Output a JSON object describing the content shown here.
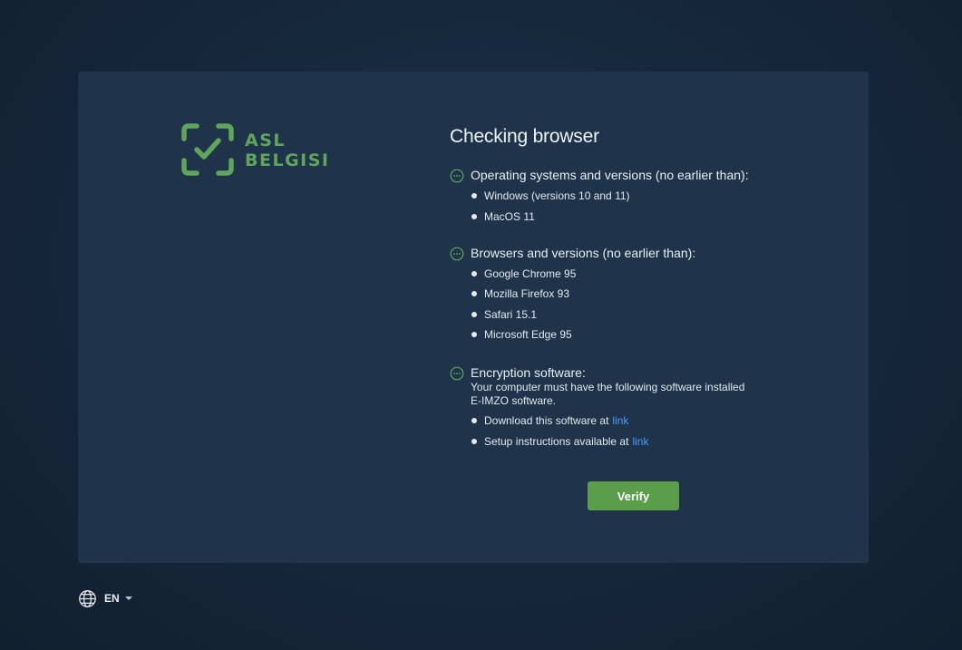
{
  "logo": {
    "line1": "ASL",
    "line2": "BELGISI",
    "color": "#5fa55a"
  },
  "title": "Checking browser",
  "sections": [
    {
      "title": "Operating systems and versions (no earlier than):",
      "items": [
        "Windows (versions 10 and 11)",
        "MacOS 11"
      ]
    },
    {
      "title": "Browsers and versions (no earlier than):",
      "items": [
        "Google Chrome 95",
        "Mozilla Firefox 93",
        "Safari 15.1",
        "Microsoft Edge 95"
      ]
    },
    {
      "title": "Encryption software:",
      "desc1": "Your computer must have the following software installed",
      "desc2": "E-IMZO software.",
      "items": [
        {
          "text": "Download this software at",
          "link": "link"
        },
        {
          "text": "Setup instructions available at",
          "link": "link"
        }
      ]
    }
  ],
  "verify_label": "Verify",
  "language": {
    "code": "EN"
  },
  "colors": {
    "accent": "#5a9e4b",
    "link": "#4a9bff",
    "card": "#1f344a",
    "background": "#15263a"
  }
}
